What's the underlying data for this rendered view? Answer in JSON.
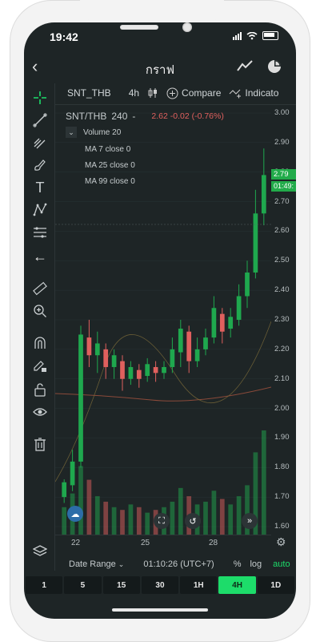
{
  "status": {
    "time": "19:42"
  },
  "header": {
    "title": "กราฟ"
  },
  "toolbar": {
    "symbol": "SNT_THB",
    "interval": "4h",
    "compare": "Compare",
    "indicators": "Indicato"
  },
  "legend": {
    "pair": "SNT/THB",
    "resolution": "240",
    "dash": "-",
    "price_info": "2.62 -0.02 (-0.76%)",
    "volume": "Volume 20",
    "ma7": "MA 7 close 0",
    "ma25": "MA 25 close 0",
    "ma99": "MA 99 close 0"
  },
  "price_axis": [
    "3.00",
    "2.90",
    "2.80",
    "2.70",
    "2.60",
    "2.50",
    "2.40",
    "2.30",
    "2.20",
    "2.10",
    "2.00",
    "1.90",
    "1.80",
    "1.70",
    "1.60"
  ],
  "price_tags": {
    "last": "2.79",
    "countdown": "01:49:"
  },
  "date_axis": [
    "22",
    "25",
    "28"
  ],
  "bottom": {
    "date_range": "Date Range",
    "time": "01:10:26 (UTC+7)",
    "percent": "%",
    "log": "log",
    "auto": "auto"
  },
  "intervals": [
    "1",
    "5",
    "15",
    "30",
    "1H",
    "4H",
    "1D"
  ],
  "active_interval": "4H",
  "colors": {
    "up": "#1fa84e",
    "down": "#e0605e",
    "accent": "#1ddc6a",
    "bg": "#1e2526"
  },
  "chart_data": {
    "type": "candlestick",
    "ylim": [
      1.6,
      3.0
    ],
    "candles": [
      [
        1.7,
        1.75,
        1.68,
        1.76
      ],
      [
        1.74,
        1.82,
        1.72,
        1.86
      ],
      [
        1.82,
        2.25,
        1.8,
        2.28
      ],
      [
        2.24,
        2.18,
        2.14,
        2.3
      ],
      [
        2.18,
        2.22,
        2.12,
        2.26
      ],
      [
        2.2,
        2.14,
        2.1,
        2.22
      ],
      [
        2.14,
        2.18,
        2.1,
        2.2
      ],
      [
        2.16,
        2.1,
        2.06,
        2.18
      ],
      [
        2.1,
        2.14,
        2.08,
        2.16
      ],
      [
        2.13,
        2.1,
        2.07,
        2.15
      ],
      [
        2.11,
        2.15,
        2.09,
        2.17
      ],
      [
        2.14,
        2.12,
        2.09,
        2.16
      ],
      [
        2.12,
        2.14,
        2.1,
        2.16
      ],
      [
        2.14,
        2.2,
        2.12,
        2.24
      ],
      [
        2.19,
        2.27,
        2.14,
        2.3
      ],
      [
        2.26,
        2.16,
        2.12,
        2.28
      ],
      [
        2.16,
        2.2,
        2.14,
        2.24
      ],
      [
        2.2,
        2.24,
        2.18,
        2.27
      ],
      [
        2.24,
        2.34,
        2.22,
        2.38
      ],
      [
        2.32,
        2.26,
        2.22,
        2.34
      ],
      [
        2.27,
        2.31,
        2.24,
        2.34
      ],
      [
        2.3,
        2.38,
        2.28,
        2.42
      ],
      [
        2.38,
        2.46,
        2.34,
        2.5
      ],
      [
        2.46,
        2.66,
        2.44,
        2.74
      ],
      [
        2.66,
        2.79,
        2.62,
        2.88
      ]
    ],
    "volume": [
      10,
      15,
      25,
      20,
      14,
      12,
      10,
      9,
      11,
      10,
      8,
      9,
      10,
      12,
      17,
      14,
      11,
      12,
      16,
      13,
      11,
      14,
      18,
      30,
      38
    ]
  }
}
